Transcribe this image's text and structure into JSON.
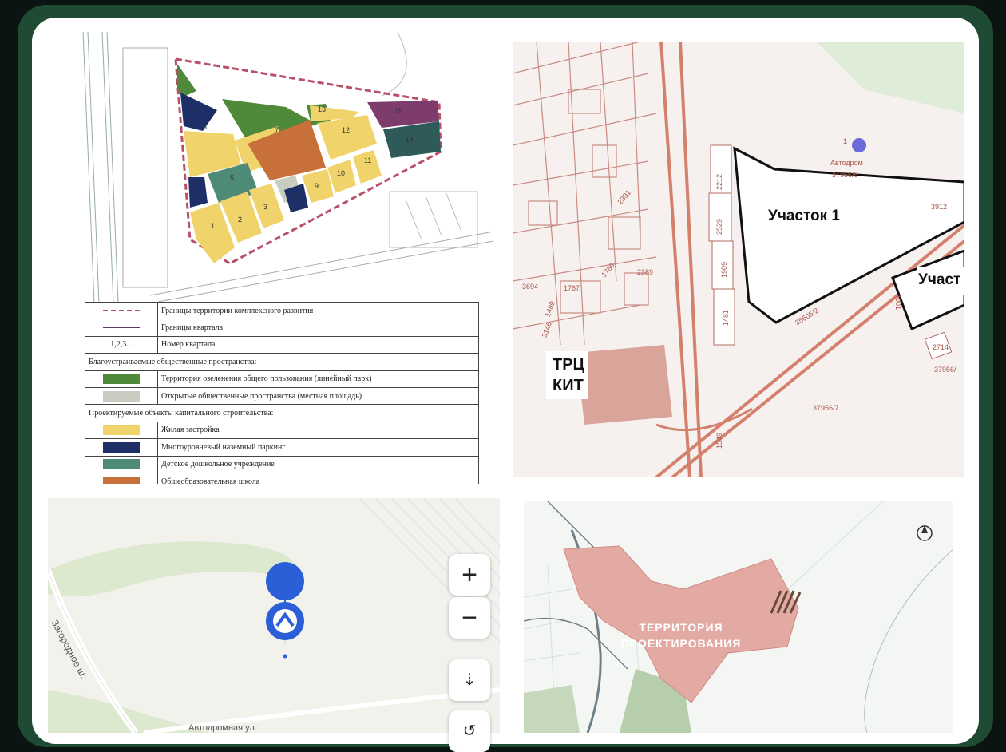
{
  "plan": {
    "blocks": [
      "1",
      "2",
      "3",
      "4",
      "5",
      "6",
      "7",
      "8",
      "9",
      "10",
      "11",
      "12",
      "13",
      "14",
      "15"
    ],
    "legend": [
      {
        "label": "Границы территории комплексного развития",
        "symbol": "dash"
      },
      {
        "label": "Границы квартала",
        "symbol": "line"
      },
      {
        "label": "Номер квартала",
        "symbol_text": "1,2,3..."
      },
      {
        "header": "Благоустраиваемые общественные пространства:"
      },
      {
        "label": "Территория озеленения общего пользования (линейный парк)",
        "color": "#4f8a3a"
      },
      {
        "label": "Открытые общественные пространства (местная площадь)",
        "color": "#c9ccc0"
      },
      {
        "header": "Проектируемые объекты капитального строительства:"
      },
      {
        "label": "Жилая застройка",
        "color": "#f0d36a"
      },
      {
        "label": "Многоуровневый наземный паркинг",
        "color": "#1d2f66"
      },
      {
        "label": "Детское дошкольное учреждение",
        "color": "#4e8a78"
      },
      {
        "label": "Общеобразовательная школа",
        "color": "#c8703a"
      }
    ]
  },
  "cadastral": {
    "plot1": "Участок 1",
    "plot2": "Участ",
    "mall_line1": "ТРЦ",
    "mall_line2": "КИТ",
    "poi": "Автодром",
    "numbers": [
      "37956/8",
      "3912",
      "2212",
      "2529",
      "1909",
      "1481",
      "2714",
      "37956/",
      "37956/7",
      "35605/2",
      "1767",
      "1769",
      "2389",
      "2391",
      "3694",
      "3146",
      "1489",
      "4001",
      "1549",
      "1"
    ]
  },
  "map": {
    "street1": "Загородное ш.",
    "street2": "Автодромная ул.",
    "zoom_in": "+",
    "zoom_out": "−"
  },
  "project": {
    "territory_line1": "ТЕРРИТОРИЯ",
    "territory_line2": "ПРОЕКТИРОВАНИЯ"
  }
}
